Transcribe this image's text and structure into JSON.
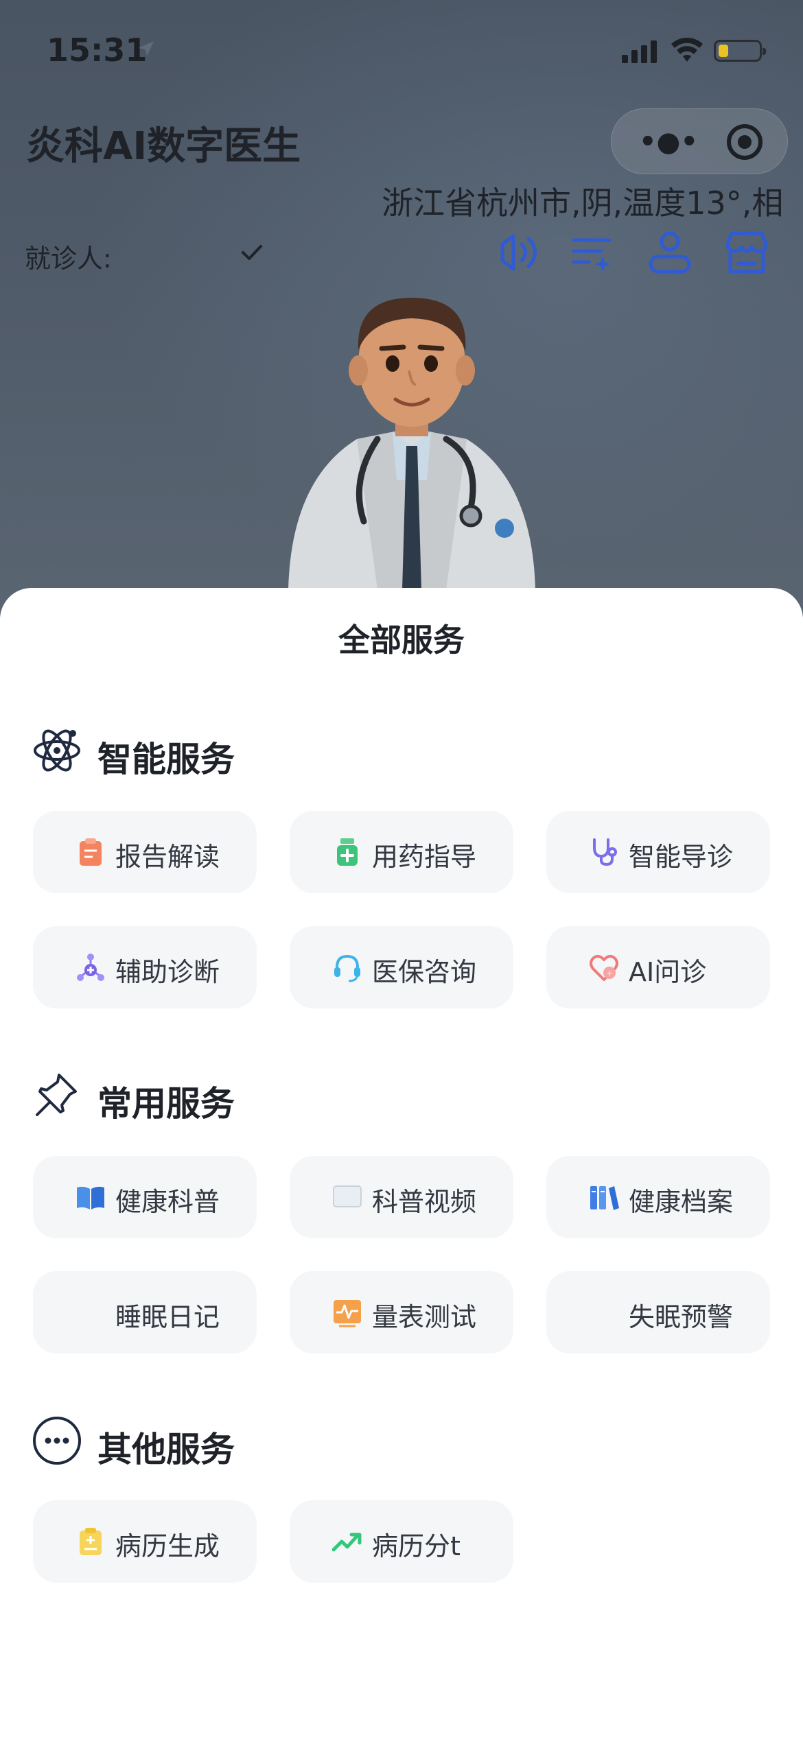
{
  "status_bar": {
    "time": "15:31"
  },
  "header": {
    "title": "炎科AI数字医生",
    "weather": "浙江省杭州市,阴,温度13°,相",
    "patient_label": "就诊人:"
  },
  "icons": {
    "location": "location-arrow-icon",
    "signal": "cellular-signal-icon",
    "wifi": "wifi-icon",
    "battery": "battery-icon",
    "more": "more-dots-icon",
    "close": "target-circle-icon",
    "speaker": "speaker-icon",
    "list": "edit-list-icon",
    "user": "user-icon",
    "store": "store-icon",
    "check": "check-icon"
  },
  "colors": {
    "accent": "#2f5bd6",
    "battery": "#e9c325"
  },
  "sheet": {
    "title": "全部服务",
    "sections": [
      {
        "label": "智能服务",
        "items": [
          {
            "label": "报告解读",
            "icon": "report-clipboard-icon"
          },
          {
            "label": "用药指导",
            "icon": "medicine-bottle-icon"
          },
          {
            "label": "智能导诊",
            "icon": "stethoscope-icon"
          },
          {
            "label": "辅助诊断",
            "icon": "molecule-icon"
          },
          {
            "label": "医保咨询",
            "icon": "headset-icon"
          },
          {
            "label": "AI问诊",
            "icon": "heart-chat-icon"
          }
        ]
      },
      {
        "label": "常用服务",
        "items": [
          {
            "label": "健康科普",
            "icon": "open-book-icon"
          },
          {
            "label": "科普视频",
            "icon": "video-icon"
          },
          {
            "label": "健康档案",
            "icon": "books-icon"
          },
          {
            "label": "睡眠日记",
            "icon": ""
          },
          {
            "label": "量表测试",
            "icon": "pulse-chart-icon"
          },
          {
            "label": "失眠预警",
            "icon": ""
          }
        ]
      },
      {
        "label": "其他服务",
        "items": [
          {
            "label": "病历生成",
            "icon": "medical-record-icon"
          },
          {
            "label": "病历分⁠t",
            "icon": "trend-up-icon"
          }
        ]
      }
    ]
  }
}
